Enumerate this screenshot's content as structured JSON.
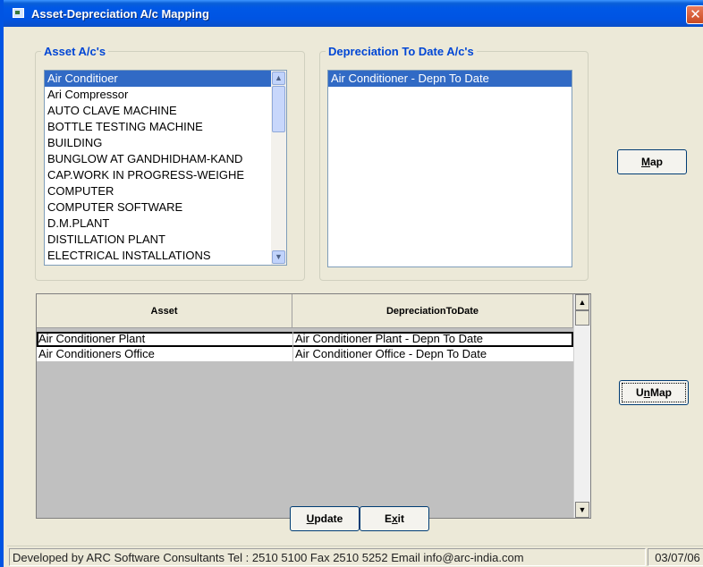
{
  "window": {
    "title": "Asset-Depreciation A/c Mapping",
    "close_glyph": "✕"
  },
  "asset_group": {
    "legend": "Asset A/c's",
    "items": [
      "Air Conditioer",
      "Ari Compressor",
      "AUTO CLAVE MACHINE",
      "BOTTLE TESTING MACHINE",
      "BUILDING",
      "BUNGLOW AT GANDHIDHAM-KAND",
      "CAP.WORK IN PROGRESS-WEIGHE",
      "COMPUTER",
      "COMPUTER SOFTWARE",
      "D.M.PLANT",
      "DISTILLATION PLANT",
      "ELECTRICAL INSTALLATIONS"
    ],
    "selected_index": 0
  },
  "depn_group": {
    "legend": "Depreciation To Date A/c's",
    "items": [
      "Air Conditioner - Depn To Date"
    ],
    "selected_index": 0
  },
  "buttons": {
    "map": {
      "mnemonic": "M",
      "rest": "ap"
    },
    "unmap": {
      "prefix": "U",
      "mnemonic": "n",
      "rest": "Map"
    },
    "update": {
      "mnemonic": "U",
      "rest": "pdate"
    },
    "exit": {
      "prefix": "E",
      "mnemonic": "x",
      "rest": "it"
    }
  },
  "grid": {
    "columns": [
      "Asset",
      "DepreciationToDate"
    ],
    "rows": [
      {
        "asset": "Air Conditioner Plant",
        "depn": "Air Conditioner Plant - Depn To Date"
      },
      {
        "asset": "Air Conditioners Office",
        "depn": "Air Conditioner Office - Depn To Date"
      }
    ]
  },
  "status": {
    "developer": "Developed by ARC Software Consultants  Tel  : 2510 5100   Fax  2510 5252   Email   info@arc-india.com",
    "date": "03/07/06"
  },
  "colors": {
    "titlebar": "#0054e3",
    "selection": "#316ac5",
    "legend": "#0046d5",
    "face": "#ece9d8"
  }
}
